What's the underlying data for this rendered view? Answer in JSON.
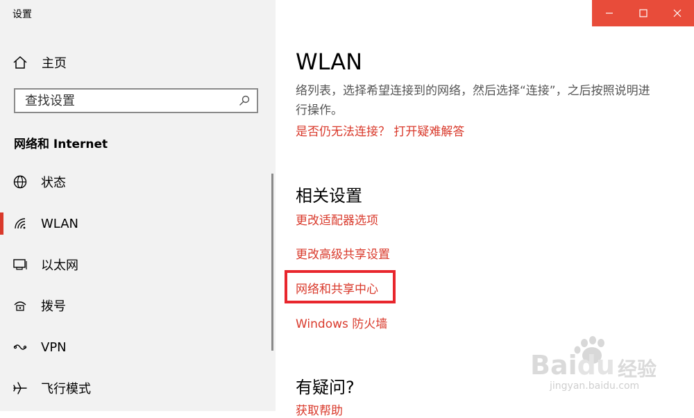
{
  "window": {
    "title": "设置"
  },
  "sidebar": {
    "home_label": "主页",
    "search_placeholder": "查找设置",
    "section_title": "网络和 Internet",
    "items": [
      {
        "label": "状态",
        "icon": "globe-icon"
      },
      {
        "label": "WLAN",
        "icon": "wifi-icon",
        "selected": true
      },
      {
        "label": "以太网",
        "icon": "ethernet-icon"
      },
      {
        "label": "拨号",
        "icon": "dialup-icon"
      },
      {
        "label": "VPN",
        "icon": "vpn-icon"
      },
      {
        "label": "飞行模式",
        "icon": "airplane-icon"
      }
    ]
  },
  "main": {
    "title": "WLAN",
    "description_line1": "络列表，选择希望连接到的网络，然后选择“连接”，之后按照说明进",
    "description_line2": "行操作。",
    "troubleshoot_link": "是否仍无法连接？ 打开疑难解答",
    "related_heading": "相关设置",
    "related_links": [
      "更改适配器选项",
      "更改高级共享设置",
      "网络和共享中心",
      "Windows 防火墙"
    ],
    "question_heading": "有疑问?",
    "help_link": "获取帮助"
  },
  "watermark": {
    "brand": "Bai",
    "brand2": "du",
    "brand_cn": "经验",
    "url": "jingyan.baidu.com"
  },
  "colors": {
    "accent": "#d9392b",
    "titlebar": "#e84c3a",
    "highlight": "#e8262d"
  }
}
